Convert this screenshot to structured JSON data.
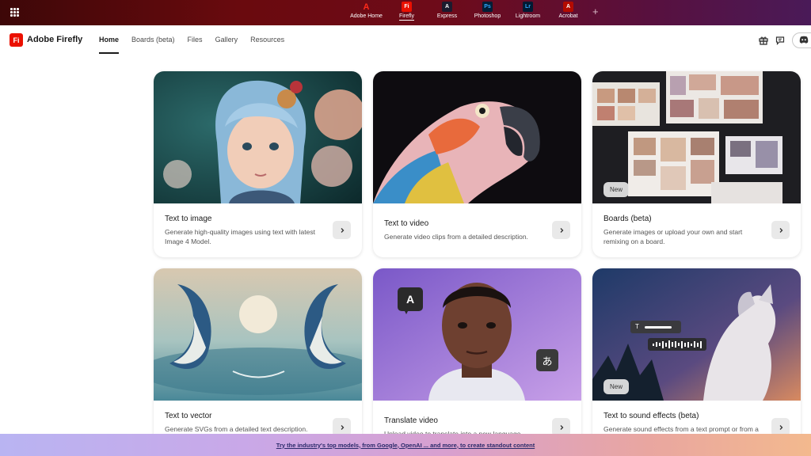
{
  "appbar": {
    "apps": [
      {
        "label": "Adobe Home",
        "icon": "adobe-logo-icon",
        "glyph": "A",
        "color": "#eb1000",
        "active": false
      },
      {
        "label": "Firefly",
        "icon": "firefly-app-icon",
        "glyph": "Fi",
        "color": "#eb1000",
        "active": true
      },
      {
        "label": "Express",
        "icon": "express-app-icon",
        "glyph": "A",
        "color": "#1b1b2e",
        "active": false
      },
      {
        "label": "Photoshop",
        "icon": "photoshop-app-icon",
        "glyph": "Ps",
        "color": "#001e36",
        "active": false
      },
      {
        "label": "Lightroom",
        "icon": "lightroom-app-icon",
        "glyph": "Lr",
        "color": "#001a33",
        "active": false
      },
      {
        "label": "Acrobat",
        "icon": "acrobat-app-icon",
        "glyph": "A",
        "color": "#b30b00",
        "active": false
      }
    ],
    "plus": "+"
  },
  "header": {
    "logo_glyph": "Fi",
    "brand": "Adobe Firefly",
    "nav": [
      {
        "label": "Home",
        "active": true
      },
      {
        "label": "Boards (beta)",
        "active": false
      },
      {
        "label": "Files",
        "active": false
      },
      {
        "label": "Gallery",
        "active": false
      },
      {
        "label": "Resources",
        "active": false
      }
    ]
  },
  "cards": [
    {
      "title": "Text to image",
      "desc": "Generate high-quality images using text with latest Image 4 Model.",
      "badge": ""
    },
    {
      "title": "Text to video",
      "desc": "Generate video clips from a detailed description.",
      "badge": ""
    },
    {
      "title": "Boards (beta)",
      "desc": "Generate images or upload your own and start remixing on a board.",
      "badge": "New"
    },
    {
      "title": "Text to vector",
      "desc": "Generate SVGs from a detailed text description.",
      "badge": ""
    },
    {
      "title": "Translate video",
      "desc": "Upload video to translate into a new language.",
      "badge": "",
      "overlay_letter": "A",
      "overlay_glyph": "あ"
    },
    {
      "title": "Text to sound effects (beta)",
      "desc": "Generate sound effects from a text prompt or from a",
      "badge": "New"
    }
  ],
  "promo": {
    "text": "Try the industry's top models, from Google, OpenAI ... and more, to create standout content"
  },
  "colors": {
    "accent": "#eb1000",
    "appbar_start": "#3d0708",
    "appbar_end": "#4a1a58"
  }
}
